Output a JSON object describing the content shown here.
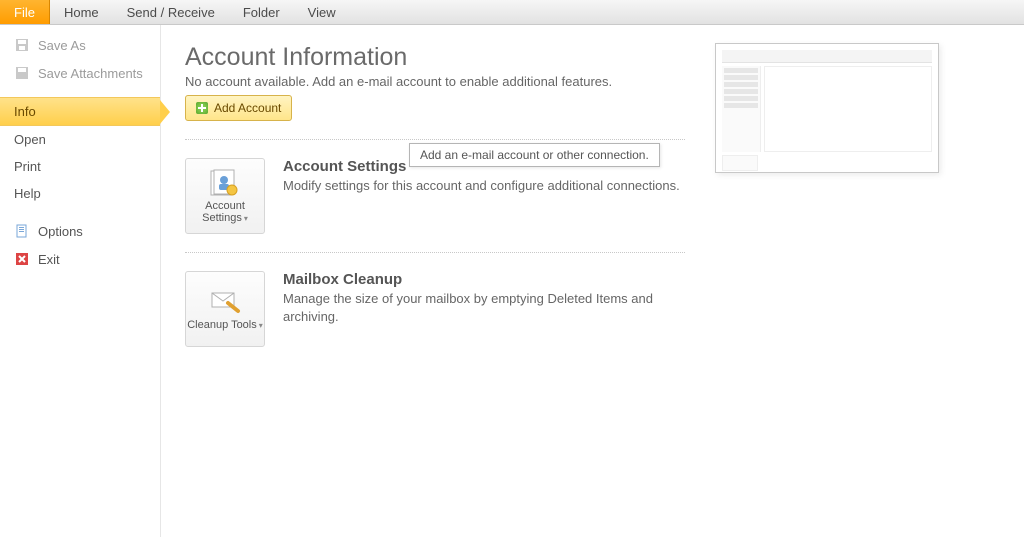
{
  "tabs": {
    "file": "File",
    "home": "Home",
    "send_receive": "Send / Receive",
    "folder": "Folder",
    "view": "View"
  },
  "sidebar": {
    "save_as": "Save As",
    "save_attachments": "Save Attachments",
    "info": "Info",
    "open": "Open",
    "print": "Print",
    "help": "Help",
    "options": "Options",
    "exit": "Exit"
  },
  "page": {
    "title": "Account Information",
    "subtitle": "No account available. Add an e-mail account to enable additional features.",
    "add_account": "Add Account",
    "tooltip": "Add an e-mail account or other connection."
  },
  "account_settings": {
    "button": "Account Settings",
    "heading": "Account Settings",
    "desc": "Modify settings for this account and configure additional connections."
  },
  "mailbox_cleanup": {
    "button": "Cleanup Tools",
    "heading": "Mailbox Cleanup",
    "desc": "Manage the size of your mailbox by emptying Deleted Items and archiving."
  }
}
